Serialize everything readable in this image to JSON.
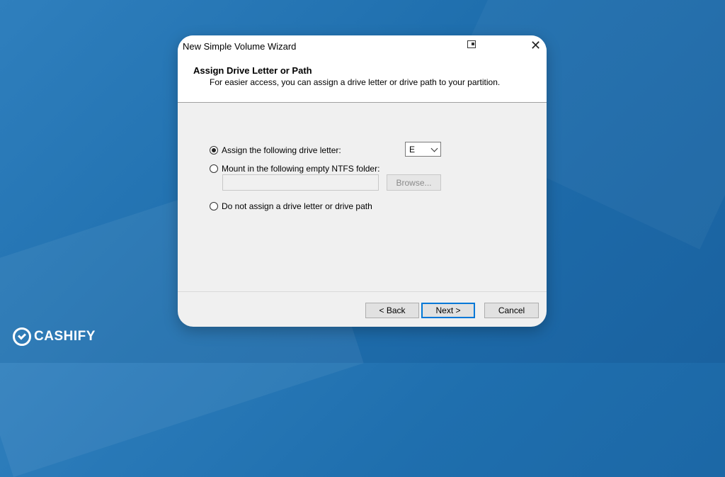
{
  "window": {
    "title": "New Simple Volume Wizard",
    "icon": "window-restore-icon",
    "close_label": "✕"
  },
  "header": {
    "title": "Assign Drive Letter or Path",
    "subtitle": "For easier access, you can assign a drive letter or drive path to your partition."
  },
  "options": {
    "assign_letter": {
      "label": "Assign the following drive letter:",
      "selected": true
    },
    "mount_folder": {
      "label": "Mount in the following empty NTFS folder:",
      "selected": false
    },
    "no_assign": {
      "label": "Do not assign a drive letter or drive path",
      "selected": false
    }
  },
  "drive_letter": {
    "value": "E"
  },
  "folder_path": {
    "value": ""
  },
  "browse": {
    "label": "Browse..."
  },
  "buttons": {
    "back": "< Back",
    "next": "Next >",
    "cancel": "Cancel"
  },
  "brand": {
    "name": "CASHIFY"
  }
}
